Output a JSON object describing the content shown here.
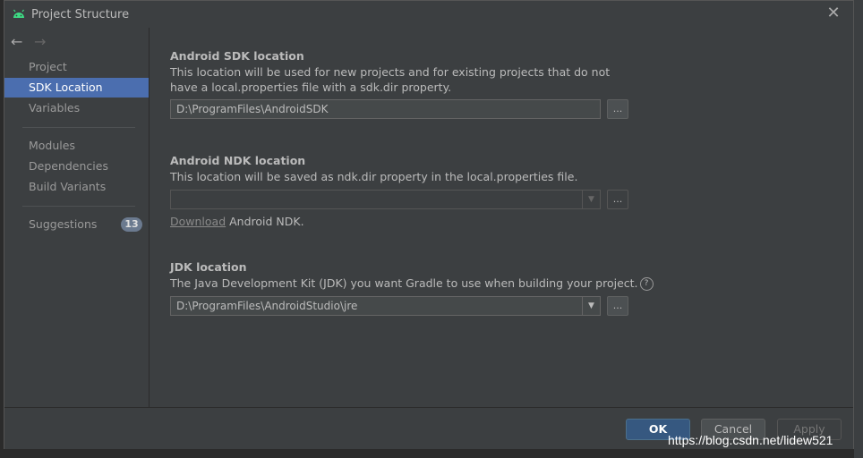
{
  "window": {
    "title": "Project Structure"
  },
  "sidebar": {
    "items": [
      {
        "label": "Project"
      },
      {
        "label": "SDK Location"
      },
      {
        "label": "Variables"
      },
      {
        "label": "Modules"
      },
      {
        "label": "Dependencies"
      },
      {
        "label": "Build Variants"
      },
      {
        "label": "Suggestions",
        "badge": "13"
      }
    ],
    "selected": "SDK Location"
  },
  "sdk": {
    "title": "Android SDK location",
    "description": "This location will be used for new projects and for existing projects that do not have a local.properties file with a sdk.dir property.",
    "value": "D:\\ProgramFiles\\AndroidSDK",
    "browse_label": "..."
  },
  "ndk": {
    "title": "Android NDK location",
    "description": "This location will be saved as ndk.dir property in the local.properties file.",
    "value": "",
    "browse_label": "...",
    "download_link": "Download",
    "download_suffix": " Android NDK."
  },
  "jdk": {
    "title": "JDK location",
    "description": "The Java Development Kit (JDK) you want Gradle to use when building your project.",
    "value": "D:\\ProgramFiles\\AndroidStudio\\jre",
    "browse_label": "...",
    "help_glyph": "?"
  },
  "footer": {
    "ok_label": "OK",
    "cancel_label": "Cancel",
    "apply_label": "Apply"
  },
  "watermark": "https://blog.csdn.net/lidew521",
  "icons": {
    "app": "android-icon",
    "close": "close-icon",
    "back": "back-arrow-icon",
    "forward": "forward-arrow-icon",
    "dropdown": "chevron-down-icon",
    "help": "help-icon"
  },
  "colors": {
    "selection": "#4b6eaf",
    "ok_button": "#365880",
    "android_green": "#3ddc84"
  }
}
